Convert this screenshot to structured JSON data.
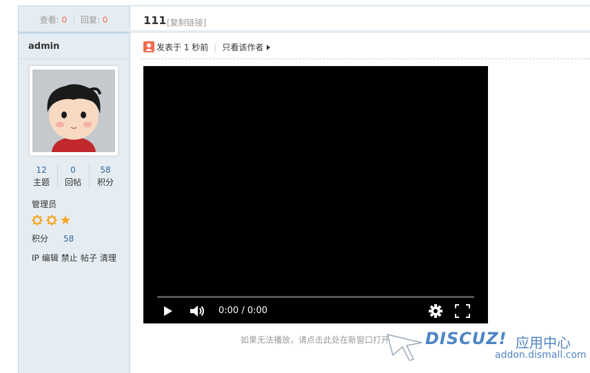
{
  "sidebar": {
    "stats_bar": {
      "views_label": "查看:",
      "views_value": "0",
      "replies_label": "回复:",
      "replies_value": "0",
      "separator": "|"
    },
    "author": "admin",
    "counts": [
      {
        "value": "12",
        "label": "主题"
      },
      {
        "value": "0",
        "label": "回帖"
      },
      {
        "value": "58",
        "label": "积分"
      }
    ],
    "group": "管理员",
    "stars": [
      "sun-icon",
      "sun-icon",
      "star-icon"
    ],
    "credits_label": "积分",
    "credits_value": "58",
    "actions": [
      "IP",
      "编辑",
      "禁止",
      "帖子",
      "清理"
    ]
  },
  "post": {
    "title": "111",
    "copy_link": "[复制链接]",
    "posted": "发表于 1 秒前",
    "pipe": "|",
    "author_only": "只看该作者",
    "fallback_text": "如果无法播放，请点击此处在新窗口打开"
  },
  "video": {
    "time": "0:00 / 0:00",
    "progress": 0
  },
  "watermark": {
    "logo": "DISCUZ!",
    "cn": "应用中心",
    "url": "addon.dismall.com"
  },
  "colors": {
    "accent_red": "#f26c4f",
    "link_blue": "#336699",
    "sidebar_bg": "#e5edf2",
    "star_orange": "#f5a623",
    "watermark_blue": "#4e84c4"
  }
}
